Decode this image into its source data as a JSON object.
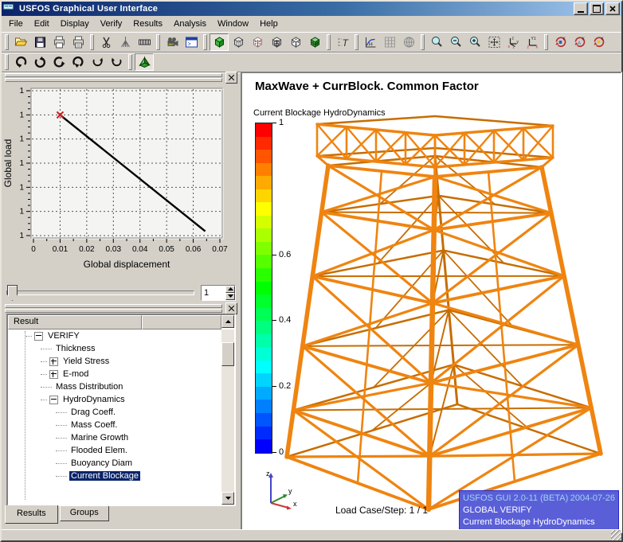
{
  "window": {
    "title": "USFOS Graphical User Interface",
    "controls": [
      "minimize",
      "maximize",
      "close"
    ]
  },
  "menu_items": [
    "File",
    "Edit",
    "Display",
    "Verify",
    "Results",
    "Analysis",
    "Window",
    "Help"
  ],
  "toolbar_row1": {
    "groups": [
      {
        "icons": [
          "open-file-icon",
          "save-icon",
          "print-icon",
          "print-copy-icon"
        ]
      },
      {
        "icons": [
          "cut-icon",
          "brush-icon",
          "film-icon"
        ]
      },
      {
        "icons": [
          "camera-icon",
          "console-icon"
        ]
      },
      {
        "icons": [
          "cube-solid-icon",
          "cube-wire-icon",
          "cube-red-dots-icon",
          "cube-pie-icon",
          "cube-dots-icon",
          "cube-mesh-icon"
        ],
        "pressed": "cube-solid-icon"
      },
      {
        "icons": [
          "label-tool-icon"
        ]
      },
      {
        "icons": [
          "plot-history-icon",
          "grid-icon",
          "globe-icon"
        ]
      },
      {
        "icons": [
          "zoom-icon",
          "zoom-out-icon",
          "zoom-in-icon",
          "zoom-extents-icon",
          "axes-xyz-icon",
          "axes-view-icon"
        ]
      },
      {
        "icons": [
          "rotate-view-x-icon",
          "rotate-view-y-icon",
          "rotate-view-z-icon"
        ]
      }
    ]
  },
  "toolbar_row2": {
    "groups": [
      {
        "icons": [
          "rotate-cw-down-icon",
          "rotate-ccw-up-icon",
          "rotate-left-icon",
          "undo-rotate-icon",
          "spin-cw-icon",
          "spin-ccw-icon"
        ]
      },
      {
        "icons": [
          "shaded-view-icon"
        ],
        "pressed": "shaded-view-icon"
      }
    ]
  },
  "plot_panel": {
    "slider_value": "1"
  },
  "chart_data": {
    "type": "line",
    "title": "",
    "xlabel": "Global displacement",
    "ylabel": "Global load",
    "xlim": [
      0,
      0.07
    ],
    "x_tick_labels": [
      "0",
      "0.01",
      "0.02",
      "0.03",
      "0.04",
      "0.05",
      "0.06",
      "0.07"
    ],
    "y_tick_labels": [
      "1",
      "1",
      "1",
      "1",
      "1",
      "1",
      "1"
    ],
    "grid": "dashed",
    "series": [
      {
        "name": "global-load-vs-displacement",
        "color": "#000000",
        "points": [
          {
            "x": 0.01,
            "y_frac_from_top": 0.167
          },
          {
            "x": 0.0645,
            "y_frac_from_top": 0.97
          }
        ]
      }
    ],
    "marker": {
      "x": 0.01,
      "y_frac_from_top": 0.167,
      "shape": "x",
      "color": "#cc2020"
    }
  },
  "tree_panel": {
    "header": "Result",
    "items": [
      {
        "label": "VERIFY",
        "level": 0,
        "expander": "minus",
        "selected": false
      },
      {
        "label": "Thickness",
        "level": 1,
        "expander": "none",
        "selected": false
      },
      {
        "label": "Yield Stress",
        "level": 1,
        "expander": "plus",
        "selected": false
      },
      {
        "label": "E-mod",
        "level": 1,
        "expander": "plus",
        "selected": false
      },
      {
        "label": "Mass Distribution",
        "level": 1,
        "expander": "none",
        "selected": false
      },
      {
        "label": "HydroDynamics",
        "level": 1,
        "expander": "minus",
        "selected": false
      },
      {
        "label": "Drag Coeff.",
        "level": 2,
        "expander": "none",
        "selected": false
      },
      {
        "label": "Mass Coeff.",
        "level": 2,
        "expander": "none",
        "selected": false
      },
      {
        "label": "Marine Growth",
        "level": 2,
        "expander": "none",
        "selected": false
      },
      {
        "label": "Flooded Elem.",
        "level": 2,
        "expander": "none",
        "selected": false
      },
      {
        "label": "Buoyancy Diam",
        "level": 2,
        "expander": "none",
        "selected": false
      },
      {
        "label": "Current Blockage",
        "level": 2,
        "expander": "none",
        "selected": true
      }
    ],
    "tabs": [
      {
        "label": "Results",
        "active": true
      },
      {
        "label": "Groups",
        "active": false
      }
    ]
  },
  "viewport": {
    "title": "MaxWave + CurrBlock. Common Factor",
    "legend_label": "Current Blockage HydroDynamics",
    "colorbar": {
      "top_color": "#ff0000",
      "bottom_color": "#0000ff",
      "bands": 25,
      "ticks": [
        {
          "label": "1",
          "frac": 0
        },
        {
          "label": "0.6",
          "frac": 0.4
        },
        {
          "label": "0.4",
          "frac": 0.6
        },
        {
          "label": "0.2",
          "frac": 0.8
        },
        {
          "label": "0",
          "frac": 1
        }
      ]
    },
    "structure_color": "#ef8410",
    "structure_shadow_color": "#c76d00",
    "load_case_text": "Load Case/Step: 1 / 1",
    "axis_triad": {
      "x_label": "x",
      "y_label": "y",
      "z_label": "z",
      "x_color": "#cc3333",
      "y_color": "#2a8a2a",
      "z_color": "#4444cc"
    },
    "info_box": {
      "version_text": "USFOS GUI 2.0-11 (BETA)",
      "date_text": "2004-07-26",
      "line2": "GLOBAL VERIFY",
      "line3": "Current Blockage HydroDynamics"
    }
  }
}
